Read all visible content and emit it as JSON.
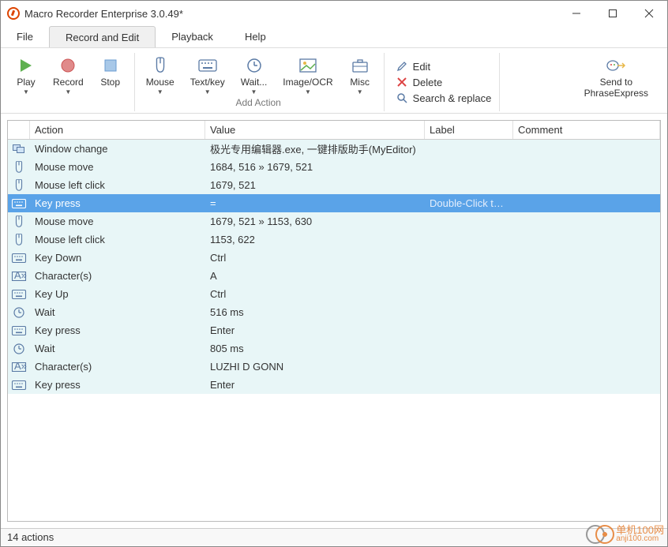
{
  "window": {
    "title": "Macro Recorder Enterprise 3.0.49*"
  },
  "menu": {
    "file": "File",
    "record": "Record and Edit",
    "playback": "Playback",
    "help": "Help"
  },
  "toolbar": {
    "play": "Play",
    "record": "Record",
    "stop": "Stop",
    "mouse": "Mouse",
    "textkey": "Text/key",
    "wait": "Wait...",
    "imageocr": "Image/OCR",
    "misc": "Misc",
    "group_label": "Add Action",
    "edit": "Edit",
    "delete": "Delete",
    "search": "Search & replace",
    "sendto_l1": "Send to",
    "sendto_l2": "PhraseExpress"
  },
  "grid": {
    "headers": {
      "action": "Action",
      "value": "Value",
      "label": "Label",
      "comment": "Comment"
    },
    "rows": [
      {
        "icon": "window",
        "action": "Window change",
        "value": "极光专用编辑器.exe, 一键排版助手(MyEditor)",
        "label": "",
        "comment": ""
      },
      {
        "icon": "mouse",
        "action": "Mouse move",
        "value": "1684, 516 » 1679, 521",
        "label": "",
        "comment": ""
      },
      {
        "icon": "mouse",
        "action": "Mouse left click",
        "value": "1679, 521",
        "label": "",
        "comment": ""
      },
      {
        "icon": "keyboard",
        "action": "Key press",
        "value": "=",
        "label": "Double-Click to add",
        "comment": "",
        "selected": true
      },
      {
        "icon": "mouse",
        "action": "Mouse move",
        "value": "1679, 521 » 1153, 630",
        "label": "",
        "comment": ""
      },
      {
        "icon": "mouse",
        "action": "Mouse left click",
        "value": "1153, 622",
        "label": "",
        "comment": ""
      },
      {
        "icon": "keyboard",
        "action": "Key Down",
        "value": "Ctrl",
        "label": "",
        "comment": ""
      },
      {
        "icon": "chars",
        "action": "Character(s)",
        "value": "A",
        "label": "",
        "comment": ""
      },
      {
        "icon": "keyboard",
        "action": "Key Up",
        "value": "Ctrl",
        "label": "",
        "comment": ""
      },
      {
        "icon": "clock",
        "action": "Wait",
        "value": "516 ms",
        "label": "",
        "comment": ""
      },
      {
        "icon": "keyboard",
        "action": "Key press",
        "value": "Enter",
        "label": "",
        "comment": ""
      },
      {
        "icon": "clock",
        "action": "Wait",
        "value": "805 ms",
        "label": "",
        "comment": ""
      },
      {
        "icon": "chars",
        "action": "Character(s)",
        "value": "LUZHI D GONN",
        "label": "",
        "comment": ""
      },
      {
        "icon": "keyboard",
        "action": "Key press",
        "value": "Enter",
        "label": "",
        "comment": ""
      }
    ]
  },
  "status": {
    "text": "14 actions"
  },
  "watermark": {
    "line1": "单机100网",
    "line2": "anji100.com"
  }
}
